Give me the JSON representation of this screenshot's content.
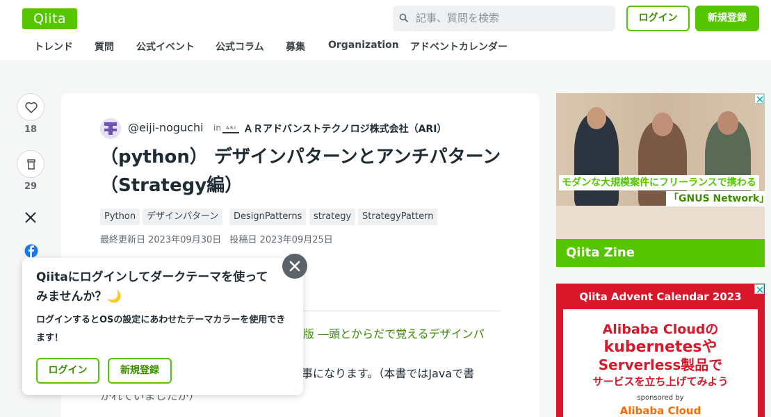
{
  "header": {
    "logo": "Qiita",
    "search_placeholder": "記事、質問を検索",
    "login_label": "ログイン",
    "signup_label": "新規登録",
    "nav": [
      "トレンド",
      "質問",
      "公式イベント",
      "公式コラム",
      "募集",
      "Organization",
      "アドベントカレンダー"
    ]
  },
  "actions": {
    "like_count": "18",
    "stock_count": "29"
  },
  "article": {
    "author": "@eiji-noguchi",
    "in_label": "in",
    "org_logo_text": "A.R.I",
    "org_name": "ＡＲアドバンストテクノロジ株式会社（ARI）",
    "title": "（python） デザインパターンとアンチパターン（Strategy編）",
    "tags": [
      "Python",
      "デザインパターン",
      "DesignPatterns",
      "strategy",
      "StrategyPattern"
    ],
    "updated": "最終更新日 2023年09月30日",
    "posted": "投稿日 2023年09月25日",
    "body_link": "版 ―頭とからだで覚えるデザインパ",
    "body_text": "事になります。（本書ではJavaで書",
    "body_text2": "かれていましたが）"
  },
  "popup": {
    "title": "Qiitaにログインしてダークテーマを使ってみませんか？🌙",
    "desc": "ログインするとOSの設定にあわせたテーマカラーを使用できます！",
    "login_label": "ログイン",
    "signup_label": "新規登録"
  },
  "ad1": {
    "caption1": "モダンな大規模案件にフリーランスで携わる",
    "caption2": "「GNUS Network」",
    "brand": "Qiita Zine"
  },
  "ad2": {
    "header": "Qiita Advent Calendar 2023",
    "line1": "Alibaba Cloudの",
    "line2": "kubernetesや",
    "line3": "Serverless製品で",
    "line4": "サービスを立ち上げてみよう",
    "sponsored": "sponsored by",
    "sponsor": "Alibaba Cloud"
  },
  "colors": {
    "brand_green": "#55c500",
    "ad_red": "#d8182a"
  }
}
